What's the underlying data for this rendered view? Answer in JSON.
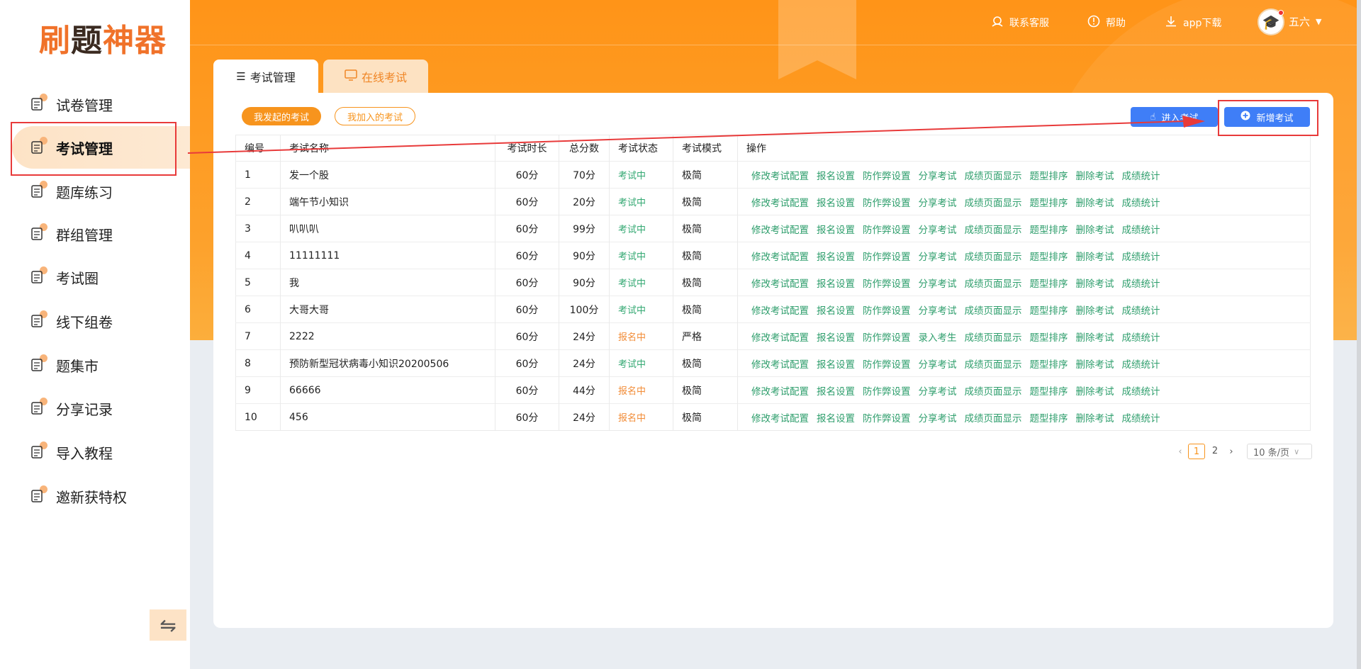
{
  "logo": {
    "part1": "刷",
    "part2": "题",
    "part3": "神器"
  },
  "sidebar": {
    "items": [
      {
        "label": "试卷管理",
        "icon": "paper-doc-icon"
      },
      {
        "label": "考试管理",
        "icon": "pencil-edit-icon",
        "active": true
      },
      {
        "label": "题库练习",
        "icon": "question-bank-icon"
      },
      {
        "label": "群组管理",
        "icon": "group-users-icon"
      },
      {
        "label": "考试圈",
        "icon": "medal-icon"
      },
      {
        "label": "线下组卷",
        "icon": "book-stack-icon"
      },
      {
        "label": "题集市",
        "icon": "store-icon"
      },
      {
        "label": "分享记录",
        "icon": "share-icon"
      },
      {
        "label": "导入教程",
        "icon": "import-icon"
      },
      {
        "label": "邀新获特权",
        "icon": "gift-badge-icon"
      }
    ],
    "collapse_symbol": "⇋"
  },
  "header": {
    "contact": "联系客服",
    "help": "帮助",
    "app_download": "app下载",
    "user_name": "五六"
  },
  "tabs": {
    "exam_mgmt": "考试管理",
    "online_exam": "在线考试"
  },
  "filters": {
    "mine": "我发起的考试",
    "joined": "我加入的考试"
  },
  "buttons": {
    "enter_exam": "进入考试",
    "new_exam": "新增考试"
  },
  "table": {
    "headers": [
      "编号",
      "考试名称",
      "考试时长",
      "总分数",
      "考试状态",
      "考试模式",
      "操作"
    ],
    "rows": [
      {
        "no": "1",
        "name": "发一个股",
        "duration": "60分",
        "score": "70分",
        "status": "考试中",
        "status_color": "#33a872",
        "mode": "极简",
        "ops": [
          "修改考试配置",
          "报名设置",
          "防作弊设置",
          "分享考试",
          "成绩页面显示",
          "题型排序",
          "删除考试",
          "成绩统计"
        ]
      },
      {
        "no": "2",
        "name": "端午节小知识",
        "duration": "60分",
        "score": "20分",
        "status": "考试中",
        "status_color": "#33a872",
        "mode": "极简",
        "ops": [
          "修改考试配置",
          "报名设置",
          "防作弊设置",
          "分享考试",
          "成绩页面显示",
          "题型排序",
          "删除考试",
          "成绩统计"
        ]
      },
      {
        "no": "3",
        "name": "叭叭叭",
        "duration": "60分",
        "score": "99分",
        "status": "考试中",
        "status_color": "#33a872",
        "mode": "极简",
        "ops": [
          "修改考试配置",
          "报名设置",
          "防作弊设置",
          "分享考试",
          "成绩页面显示",
          "题型排序",
          "删除考试",
          "成绩统计"
        ]
      },
      {
        "no": "4",
        "name": "11111111",
        "duration": "60分",
        "score": "90分",
        "status": "考试中",
        "status_color": "#33a872",
        "mode": "极简",
        "ops": [
          "修改考试配置",
          "报名设置",
          "防作弊设置",
          "分享考试",
          "成绩页面显示",
          "题型排序",
          "删除考试",
          "成绩统计"
        ]
      },
      {
        "no": "5",
        "name": "我",
        "duration": "60分",
        "score": "90分",
        "status": "考试中",
        "status_color": "#33a872",
        "mode": "极简",
        "ops": [
          "修改考试配置",
          "报名设置",
          "防作弊设置",
          "分享考试",
          "成绩页面显示",
          "题型排序",
          "删除考试",
          "成绩统计"
        ]
      },
      {
        "no": "6",
        "name": "大哥大哥",
        "duration": "60分",
        "score": "100分",
        "status": "考试中",
        "status_color": "#33a872",
        "mode": "极简",
        "ops": [
          "修改考试配置",
          "报名设置",
          "防作弊设置",
          "分享考试",
          "成绩页面显示",
          "题型排序",
          "删除考试",
          "成绩统计"
        ]
      },
      {
        "no": "7",
        "name": "2222",
        "duration": "60分",
        "score": "24分",
        "status": "报名中",
        "status_color": "#f28c37",
        "mode": "严格",
        "ops": [
          "修改考试配置",
          "报名设置",
          "防作弊设置",
          "录入考生",
          "成绩页面显示",
          "题型排序",
          "删除考试",
          "成绩统计"
        ]
      },
      {
        "no": "8",
        "name": "预防新型冠状病毒小知识20200506",
        "duration": "60分",
        "score": "24分",
        "status": "考试中",
        "status_color": "#33a872",
        "mode": "极简",
        "ops": [
          "修改考试配置",
          "报名设置",
          "防作弊设置",
          "分享考试",
          "成绩页面显示",
          "题型排序",
          "删除考试",
          "成绩统计"
        ]
      },
      {
        "no": "9",
        "name": "66666",
        "duration": "60分",
        "score": "44分",
        "status": "报名中",
        "status_color": "#f28c37",
        "mode": "极简",
        "ops": [
          "修改考试配置",
          "报名设置",
          "防作弊设置",
          "分享考试",
          "成绩页面显示",
          "题型排序",
          "删除考试",
          "成绩统计"
        ]
      },
      {
        "no": "10",
        "name": "456",
        "duration": "60分",
        "score": "24分",
        "status": "报名中",
        "status_color": "#f28c37",
        "mode": "极简",
        "ops": [
          "修改考试配置",
          "报名设置",
          "防作弊设置",
          "分享考试",
          "成绩页面显示",
          "题型排序",
          "删除考试",
          "成绩统计"
        ]
      }
    ]
  },
  "pagination": {
    "pages": [
      "1",
      "2"
    ],
    "current": "1",
    "page_size": "10 条/页"
  },
  "colors": {
    "brand_orange": "#f7941d",
    "primary_blue": "#3f7ef7",
    "link_green": "#2e9e6c",
    "annotation_red": "#e83a3a"
  }
}
